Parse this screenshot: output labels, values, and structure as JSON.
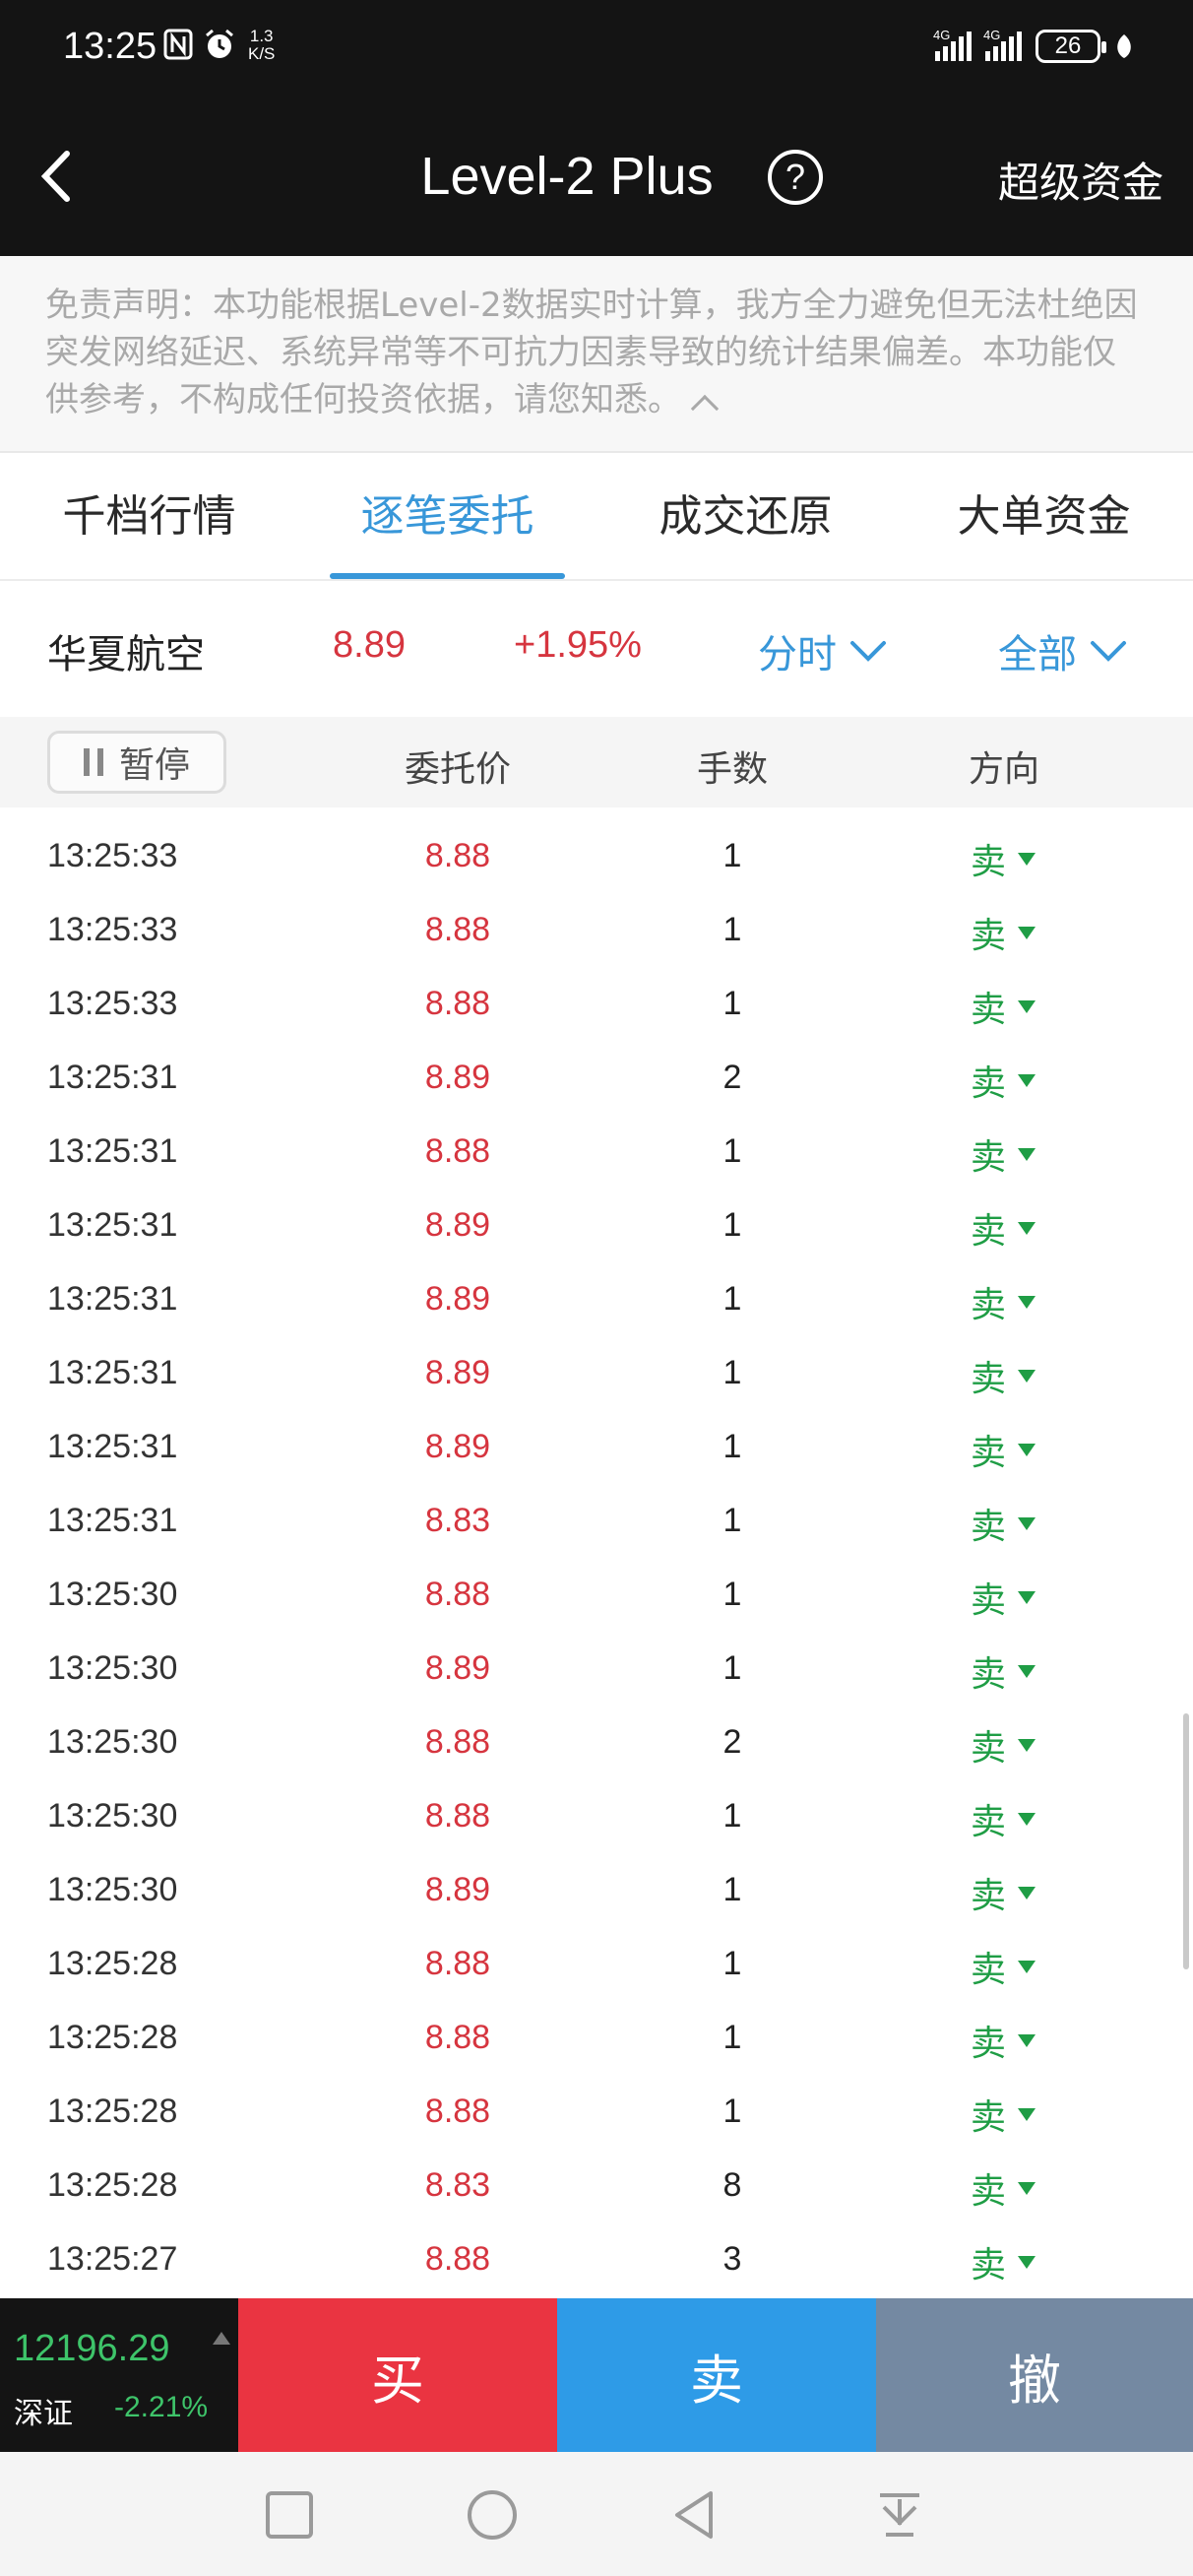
{
  "status_bar": {
    "time": "13:25",
    "net_speed_value": "1.3",
    "net_speed_unit": "K/S",
    "sim1_tag": "4G",
    "sim2_tag": "4G",
    "battery": "26"
  },
  "header": {
    "title": "Level-2 Plus",
    "help_glyph": "?",
    "right_action": "超级资金"
  },
  "disclaimer": {
    "text": "免责声明：本功能根据Level-2数据实时计算，我方全力避免但无法杜绝因突发网络延迟、系统异常等不可抗力因素导致的统计结果偏差。本功能仅供参考，不构成任何投资依据，请您知悉。"
  },
  "tabs": [
    {
      "label": "千档行情",
      "active": false
    },
    {
      "label": "逐笔委托",
      "active": true
    },
    {
      "label": "成交还原",
      "active": false
    },
    {
      "label": "大单资金",
      "active": false
    }
  ],
  "stock": {
    "name": "华夏航空",
    "price": "8.89",
    "change_pct": "+1.95%",
    "period_selector": "分时",
    "filter_selector": "全部"
  },
  "columns": {
    "pause_label": "暂停",
    "price": "委托价",
    "qty": "手数",
    "direction": "方向"
  },
  "orders": [
    {
      "time": "13:25:33",
      "price": "8.88",
      "qty": "1",
      "dir": "卖"
    },
    {
      "time": "13:25:33",
      "price": "8.88",
      "qty": "1",
      "dir": "卖"
    },
    {
      "time": "13:25:33",
      "price": "8.88",
      "qty": "1",
      "dir": "卖"
    },
    {
      "time": "13:25:31",
      "price": "8.89",
      "qty": "2",
      "dir": "卖"
    },
    {
      "time": "13:25:31",
      "price": "8.88",
      "qty": "1",
      "dir": "卖"
    },
    {
      "time": "13:25:31",
      "price": "8.89",
      "qty": "1",
      "dir": "卖"
    },
    {
      "time": "13:25:31",
      "price": "8.89",
      "qty": "1",
      "dir": "卖"
    },
    {
      "time": "13:25:31",
      "price": "8.89",
      "qty": "1",
      "dir": "卖"
    },
    {
      "time": "13:25:31",
      "price": "8.89",
      "qty": "1",
      "dir": "卖"
    },
    {
      "time": "13:25:31",
      "price": "8.83",
      "qty": "1",
      "dir": "卖"
    },
    {
      "time": "13:25:30",
      "price": "8.88",
      "qty": "1",
      "dir": "卖"
    },
    {
      "time": "13:25:30",
      "price": "8.89",
      "qty": "1",
      "dir": "卖"
    },
    {
      "time": "13:25:30",
      "price": "8.88",
      "qty": "2",
      "dir": "卖"
    },
    {
      "time": "13:25:30",
      "price": "8.88",
      "qty": "1",
      "dir": "卖"
    },
    {
      "time": "13:25:30",
      "price": "8.89",
      "qty": "1",
      "dir": "卖"
    },
    {
      "time": "13:25:28",
      "price": "8.88",
      "qty": "1",
      "dir": "卖"
    },
    {
      "time": "13:25:28",
      "price": "8.88",
      "qty": "1",
      "dir": "卖"
    },
    {
      "time": "13:25:28",
      "price": "8.88",
      "qty": "1",
      "dir": "卖"
    },
    {
      "time": "13:25:28",
      "price": "8.83",
      "qty": "8",
      "dir": "卖"
    },
    {
      "time": "13:25:27",
      "price": "8.88",
      "qty": "3",
      "dir": "卖"
    }
  ],
  "index_ticker": {
    "value": "12196.29",
    "name": "深证",
    "change": "-2.21%"
  },
  "actions": {
    "buy": "买",
    "sell": "卖",
    "cancel": "撤"
  },
  "colors": {
    "up_red": "#d6353f",
    "down_green": "#1f9d45",
    "accent_blue": "#3897d9",
    "buy_button": "#ea3441",
    "sell_button": "#2e9be7",
    "cancel_button": "#7489a2"
  }
}
